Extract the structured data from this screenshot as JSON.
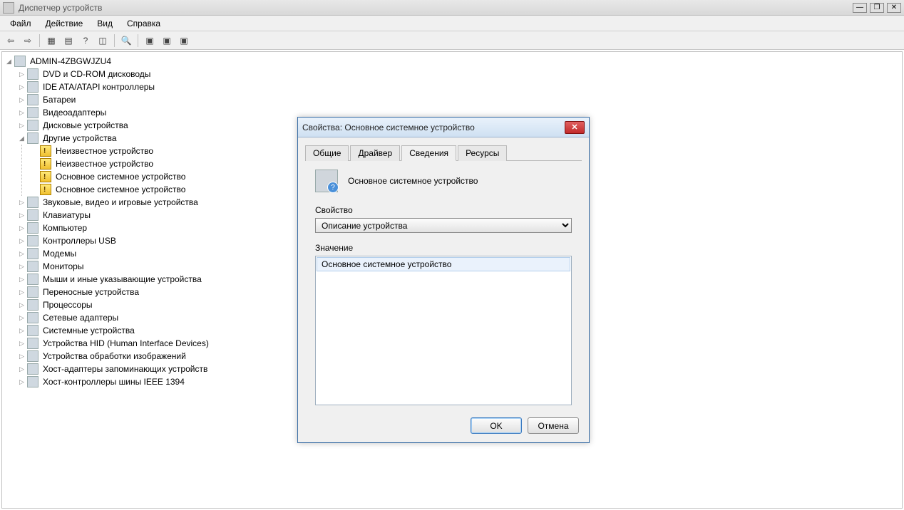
{
  "window": {
    "title": "Диспетчер устройств"
  },
  "menu": {
    "file": "Файл",
    "action": "Действие",
    "view": "Вид",
    "help": "Справка"
  },
  "tree": {
    "root": "ADMIN-4ZBGWJZU4",
    "items": [
      "DVD и CD-ROM дисководы",
      "IDE ATA/ATAPI контроллеры",
      "Батареи",
      "Видеоадаптеры",
      "Дисковые устройства"
    ],
    "other_devices_label": "Другие устройства",
    "other_devices": [
      "Неизвестное устройство",
      "Неизвестное устройство",
      "Основное системное устройство",
      "Основное системное устройство"
    ],
    "items2": [
      "Звуковые, видео и игровые устройства",
      "Клавиатуры",
      "Компьютер",
      "Контроллеры USB",
      "Модемы",
      "Мониторы",
      "Мыши и иные указывающие устройства",
      "Переносные устройства",
      "Процессоры",
      "Сетевые адаптеры",
      "Системные устройства",
      "Устройства HID (Human Interface Devices)",
      "Устройства обработки изображений",
      "Хост-адаптеры запоминающих устройств",
      "Хост-контроллеры шины IEEE 1394"
    ]
  },
  "dialog": {
    "title": "Свойства: Основное системное устройство",
    "device_name": "Основное системное устройство",
    "tabs": {
      "general": "Общие",
      "driver": "Драйвер",
      "details": "Сведения",
      "resources": "Ресурсы"
    },
    "property_label": "Свойство",
    "property_selected": "Описание устройства",
    "value_label": "Значение",
    "value_item": "Основное системное устройство",
    "ok": "OK",
    "cancel": "Отмена"
  }
}
